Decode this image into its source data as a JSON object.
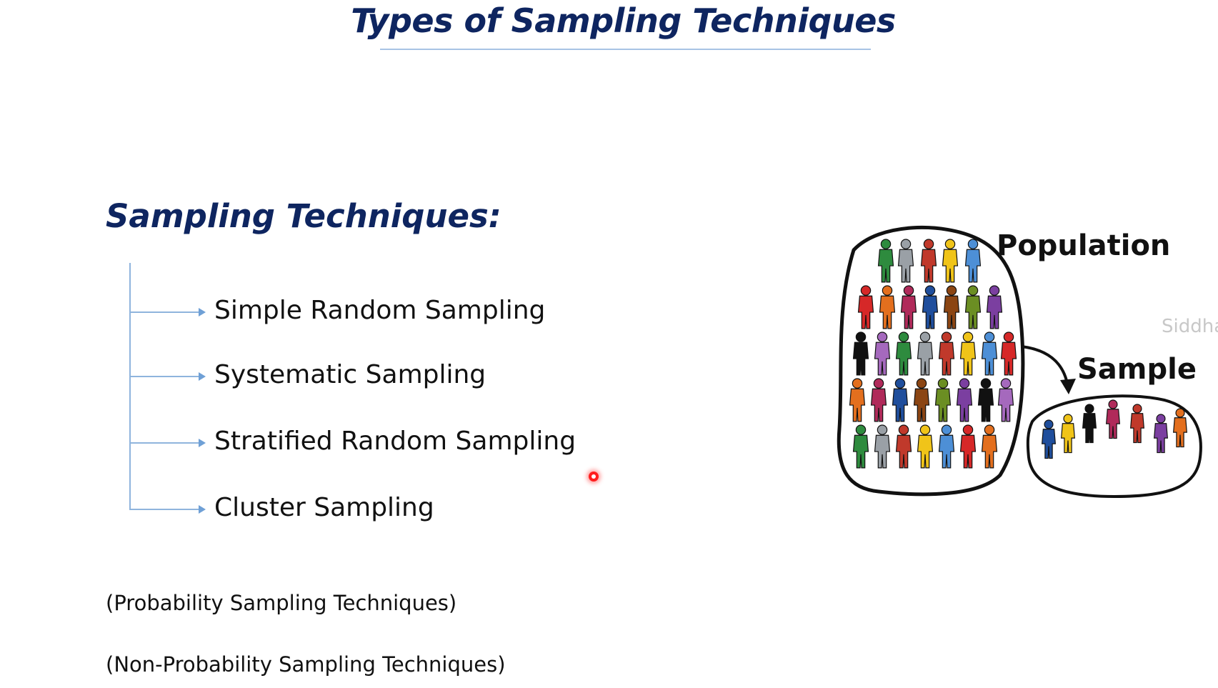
{
  "slide": {
    "title": "Types of Sampling Techniques",
    "heading": "Sampling Techniques:"
  },
  "techniques": [
    {
      "label": "Simple Random Sampling"
    },
    {
      "label": "Systematic Sampling"
    },
    {
      "label": "Stratified Random Sampling"
    },
    {
      "label": "Cluster Sampling"
    }
  ],
  "notes": {
    "probability": "(Probability Sampling Techniques)",
    "non_probability": "(Non-Probability Sampling Techniques)"
  },
  "illustration": {
    "population_label": "Population",
    "sample_label": "Sample",
    "watermark": "Siddha"
  },
  "colors": {
    "title": "#0e2560",
    "tree_lines": "#8fb4dd",
    "pointer": "#ff1e1e",
    "people": [
      "#d62828",
      "#1f4e9c",
      "#7b3fa0",
      "#2e8b3e",
      "#f0c419",
      "#e36f1e",
      "#8b4513",
      "#111111",
      "#9aa0a6",
      "#4d8fd6",
      "#b02a5a",
      "#6b8e23",
      "#a569bd",
      "#c0392b"
    ]
  }
}
